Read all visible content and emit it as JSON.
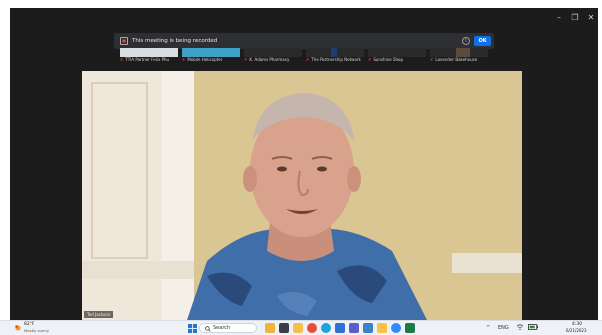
{
  "window": {
    "controls": {
      "minimize": "–",
      "maximize": "❐",
      "close": "✕"
    }
  },
  "recording_banner": {
    "text": "This meeting is being recorded",
    "ok_label": "OK",
    "icon": "record-icon",
    "info_icon": "info-icon"
  },
  "participants": [
    {
      "name": "TTIA Partner Felix Phu",
      "muted": true,
      "color": "#c9d2dc"
    },
    {
      "name": "Mobile Helicopter",
      "muted": true,
      "color": "#3fa0c8"
    },
    {
      "name": "K. Adams Pharmacy",
      "muted": true,
      "color": "#2a2a2a"
    },
    {
      "name": "The Partnership Network",
      "muted": true,
      "color": "#1f3e6e"
    },
    {
      "name": "Sunshine Shop",
      "muted": true,
      "color": "#2a2a2a"
    },
    {
      "name": "Lavender Bakehouse",
      "muted": true,
      "color": "#5b4b3d"
    }
  ],
  "main_video": {
    "speaker_name": "Ted Jackson",
    "subject": "speaker-video"
  },
  "taskbar": {
    "weather": {
      "temp": "82°F",
      "condition": "Mostly sunny"
    },
    "search_label": "Search",
    "apps": [
      {
        "name": "widgets-icon",
        "color": "#f0b43c"
      },
      {
        "name": "file-explorer-icon",
        "color": "#f2c14e"
      },
      {
        "name": "chrome-icon",
        "color": "#e84b3c"
      },
      {
        "name": "edge-icon",
        "color": "#1da1e0"
      },
      {
        "name": "mail-icon",
        "color": "#2f6fd6"
      },
      {
        "name": "teams-icon",
        "color": "#5b5fc7"
      },
      {
        "name": "store-icon",
        "color": "#3b82c4"
      },
      {
        "name": "folder-icon",
        "color": "#f6c344"
      },
      {
        "name": "zoom-icon",
        "color": "#2d8cff"
      },
      {
        "name": "excel-icon",
        "color": "#1e7a45"
      }
    ],
    "tray": {
      "chevron": "^",
      "language": "ENG",
      "wifi": "wifi-icon",
      "battery": "battery-icon"
    },
    "clock": {
      "time": "4:30",
      "date": "6/21/2023"
    }
  }
}
